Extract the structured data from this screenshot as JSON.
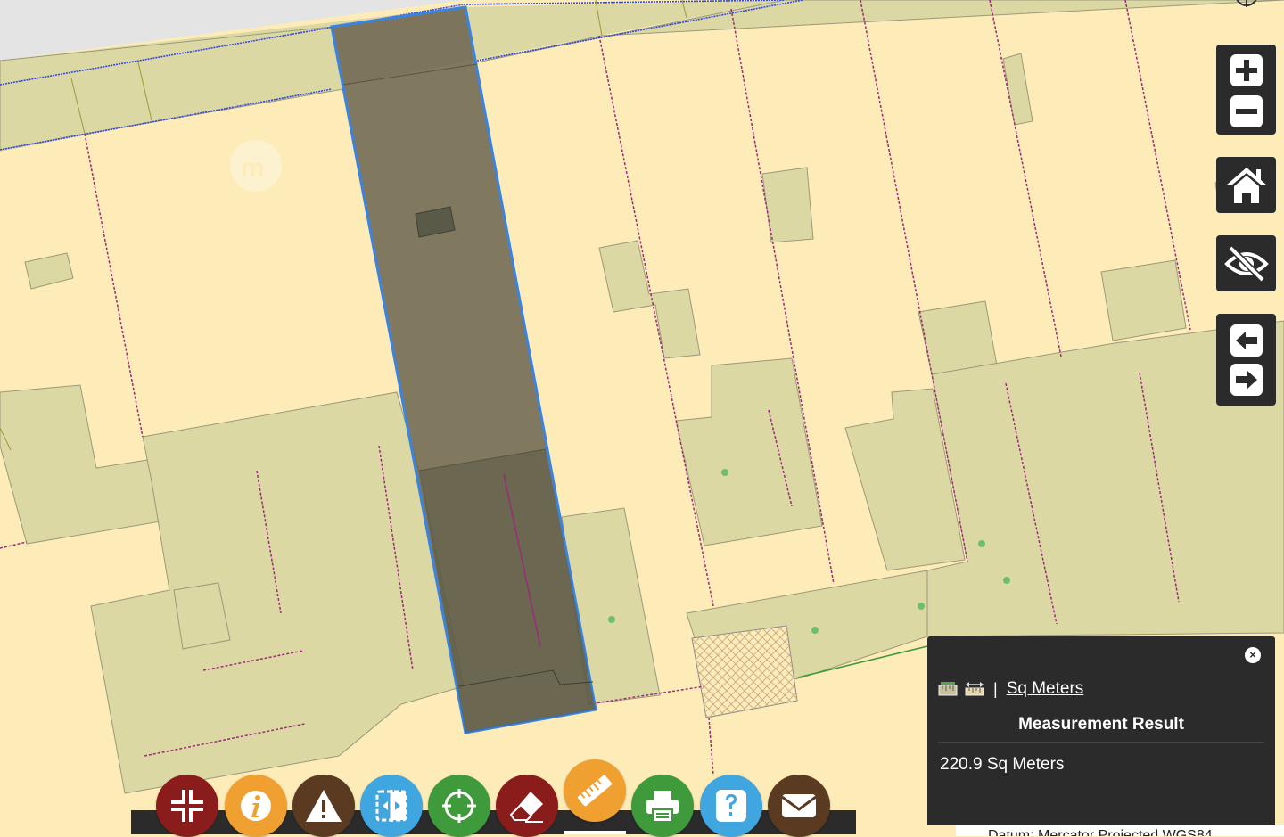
{
  "map": {
    "colors": {
      "land": "#fdebb8",
      "building": "#dcd8a3",
      "selection_fill": "#7c7256",
      "selection_border": "#3b83e0",
      "boundary": "#3247e0"
    },
    "watermark_icon": "mp-logo-icon"
  },
  "right_controls": [
    {
      "name": "zoom-in",
      "icon": "plus-icon"
    },
    {
      "name": "zoom-out",
      "icon": "minus-icon"
    },
    {
      "name": "home",
      "icon": "home-icon"
    },
    {
      "name": "toggle-visibility",
      "icon": "eye-slash-icon"
    },
    {
      "name": "previous-extent",
      "icon": "arrow-left-icon"
    },
    {
      "name": "next-extent",
      "icon": "arrow-right-icon"
    }
  ],
  "toolbar": [
    {
      "name": "collapse",
      "icon": "collapse-arrows-icon",
      "color": "#8a1c1c"
    },
    {
      "name": "info",
      "icon": "info-icon",
      "color": "#f0a030"
    },
    {
      "name": "warning",
      "icon": "warning-icon",
      "color": "#5a3b22"
    },
    {
      "name": "swipe",
      "icon": "split-view-icon",
      "color": "#3fa6e0"
    },
    {
      "name": "locate",
      "icon": "crosshair-icon",
      "color": "#3f9a3c"
    },
    {
      "name": "erase",
      "icon": "eraser-icon",
      "color": "#8a1c1c"
    },
    {
      "name": "measure",
      "icon": "ruler-icon",
      "color": "#f0a030"
    },
    {
      "name": "print",
      "icon": "printer-icon",
      "color": "#3f9a3c"
    },
    {
      "name": "help",
      "icon": "question-icon",
      "color": "#3fa6e0"
    },
    {
      "name": "email",
      "icon": "envelope-icon",
      "color": "#5a3b22"
    }
  ],
  "measurement": {
    "unit_label": "Sq Meters",
    "separator": "|",
    "title": "Measurement Result",
    "value": "220.9 Sq Meters",
    "close_symbol": "×",
    "area_tool_icon": "area-ruler-icon",
    "distance_tool_icon": "distance-ruler-icon"
  },
  "footer_note": "Datum: Mercator Projected WGS84"
}
